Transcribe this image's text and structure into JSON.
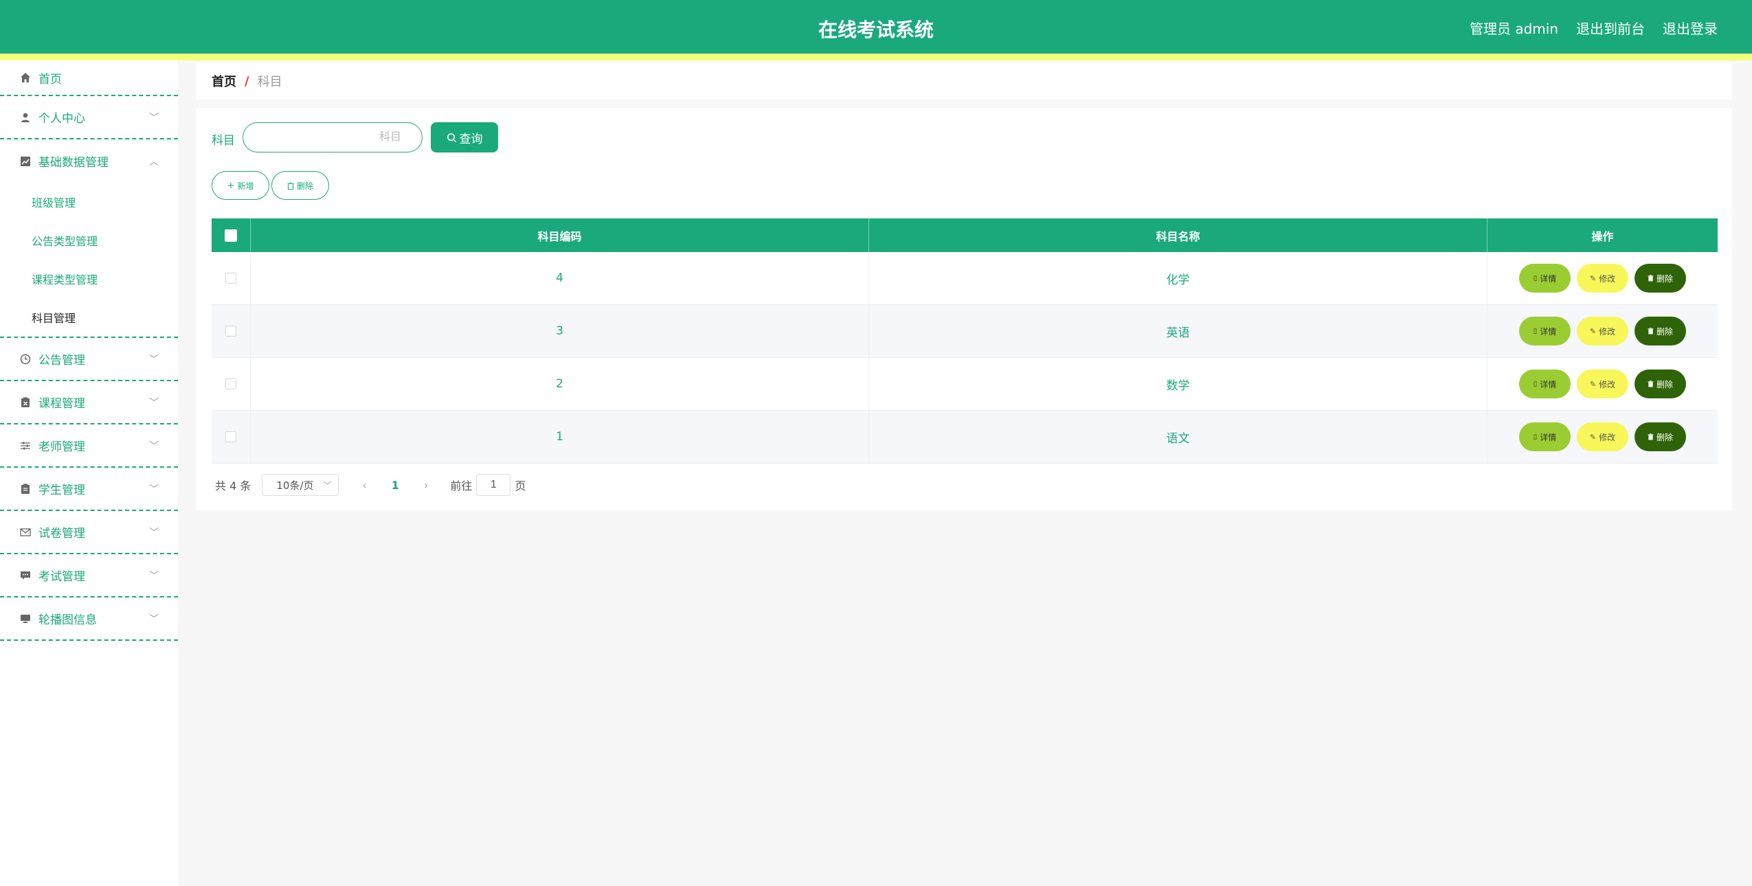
{
  "header": {
    "title": "在线考试系统",
    "admin_label": "管理员 admin",
    "to_front_label": "退出到前台",
    "logout_label": "退出登录"
  },
  "sidebar": {
    "home": {
      "label": "首页",
      "icon": "home-icon"
    },
    "items": [
      {
        "label": "个人中心",
        "icon": "user-icon"
      },
      {
        "label": "基础数据管理",
        "icon": "chart-icon",
        "expanded": true,
        "children": [
          "班级管理",
          "公告类型管理",
          "课程类型管理",
          "科目管理"
        ],
        "active_child": "科目管理"
      },
      {
        "label": "公告管理",
        "icon": "clock-icon"
      },
      {
        "label": "课程管理",
        "icon": "clipboard-x-icon"
      },
      {
        "label": "老师管理",
        "icon": "sliders-icon"
      },
      {
        "label": "学生管理",
        "icon": "clipboard-icon"
      },
      {
        "label": "试卷管理",
        "icon": "mail-icon"
      },
      {
        "label": "考试管理",
        "icon": "chat-icon"
      },
      {
        "label": "轮播图信息",
        "icon": "monitor-icon"
      }
    ]
  },
  "breadcrumb": {
    "home": "首页",
    "separator": "/",
    "current": "科目"
  },
  "search": {
    "label": "科目",
    "placeholder": "科目",
    "value": "",
    "button_label": "查询"
  },
  "actions": {
    "add_label": "新增",
    "delete_label": "删除"
  },
  "table": {
    "columns": [
      "科目编码",
      "科目名称",
      "操作"
    ],
    "rows": [
      {
        "code": "4",
        "name": "化学"
      },
      {
        "code": "3",
        "name": "英语"
      },
      {
        "code": "2",
        "name": "数学"
      },
      {
        "code": "1",
        "name": "语文"
      }
    ],
    "row_actions": {
      "detail": "详情",
      "edit": "修改",
      "delete": "删除"
    }
  },
  "pagination": {
    "total_text": "共 4 条",
    "page_size": "10条/页",
    "current_page": "1",
    "goto_prefix": "前往",
    "goto_value": "1",
    "goto_suffix": "页"
  },
  "colors": {
    "primary": "#1aa97a",
    "stripe": "#f3ff7a",
    "detail": "#9acd32",
    "edit": "#f7f75a",
    "delete": "#2e6407",
    "breadcrumb_separator": "#e0402b"
  }
}
